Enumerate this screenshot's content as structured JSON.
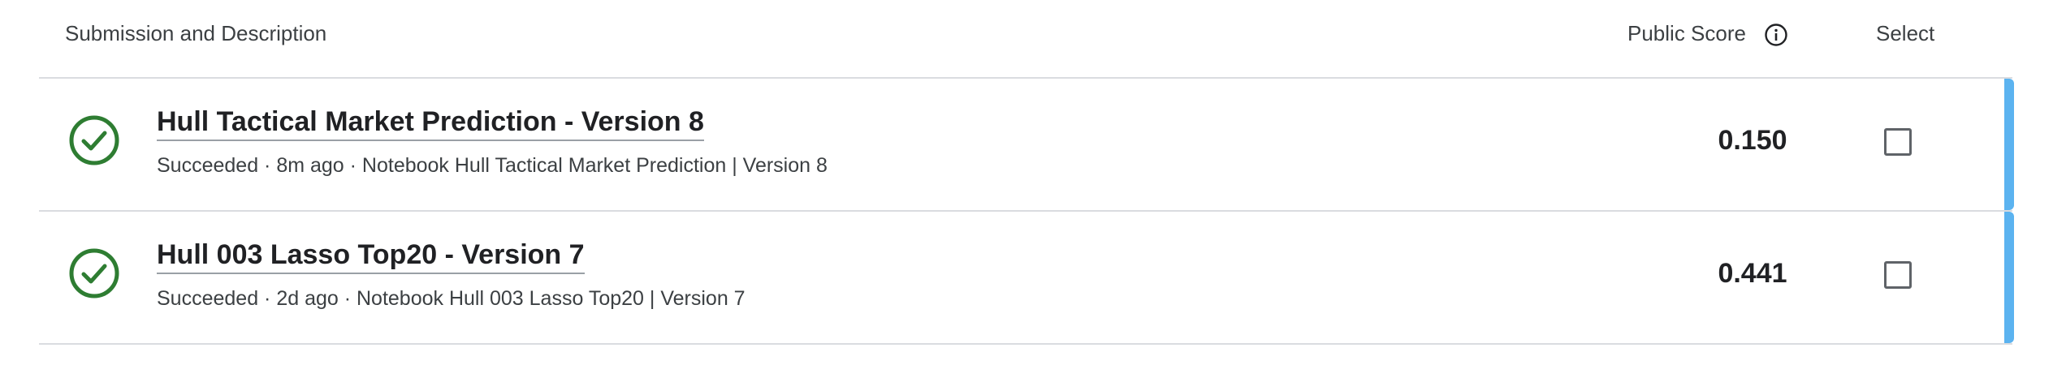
{
  "header": {
    "submission_label": "Submission and Description",
    "score_label": "Public Score",
    "select_label": "Select"
  },
  "icons": {
    "info": "info-icon",
    "status": "check-circle-icon"
  },
  "colors": {
    "success": "#2e7d32",
    "accent": "#5bb3f0"
  },
  "rows": [
    {
      "title": "Hull Tactical Market Prediction - Version 8",
      "meta": "Succeeded · 8m ago · Notebook Hull Tactical Market Prediction | Version 8",
      "score": "0.150",
      "selected": false
    },
    {
      "title": "Hull 003 Lasso Top20 - Version 7",
      "meta": "Succeeded · 2d ago · Notebook Hull 003 Lasso Top20 | Version 7",
      "score": "0.441",
      "selected": false
    }
  ]
}
